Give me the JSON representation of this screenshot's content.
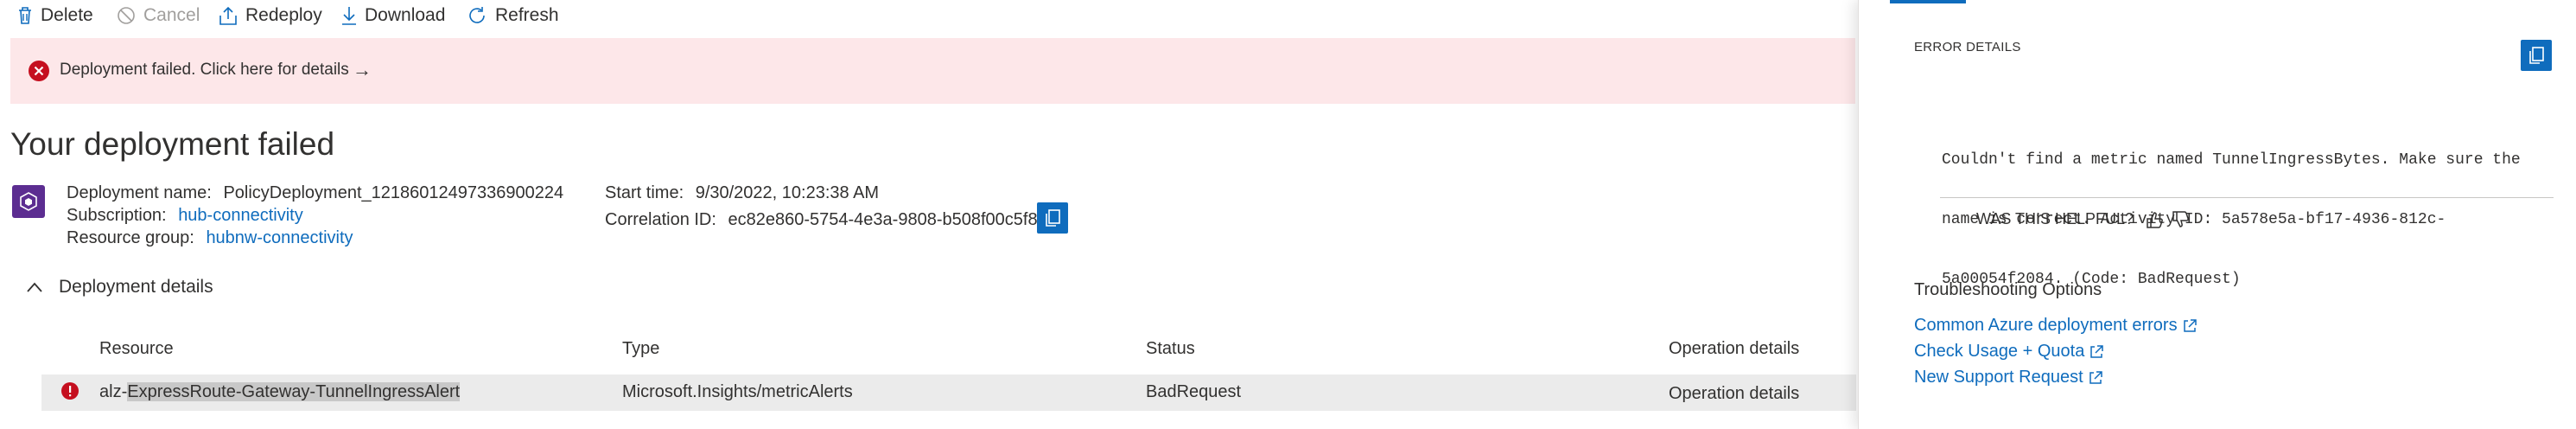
{
  "toolbar": {
    "delete": "Delete",
    "cancel": "Cancel",
    "redeploy": "Redeploy",
    "download": "Download",
    "refresh": "Refresh"
  },
  "banner": {
    "text": "Deployment failed. Click here for details",
    "arrow": "→"
  },
  "title": "Your deployment failed",
  "summary": {
    "deployment_name_label": "Deployment name:",
    "deployment_name": "PolicyDeployment_12186012497336900224",
    "subscription_label": "Subscription:",
    "subscription": "hub-connectivity",
    "resource_group_label": "Resource group:",
    "resource_group": "hubnw-connectivity",
    "start_time_label": "Start time:",
    "start_time": "9/30/2022, 10:23:38 AM",
    "correlation_label": "Correlation ID:",
    "correlation_id": "ec82e860-5754-4e3a-9808-b508f00c5f87"
  },
  "details": {
    "section_label": "Deployment details",
    "columns": [
      "Resource",
      "Type",
      "Status",
      "Operation details"
    ],
    "row": {
      "resource_prefix": "alz-",
      "resource_highlight": "ExpressRoute-Gateway-TunnelIngressAlert",
      "type": "Microsoft.Insights/metricAlerts",
      "status": "BadRequest",
      "operation": "Operation details"
    }
  },
  "panel": {
    "header": "ERROR DETAILS",
    "message_lines": [
      "Couldn't find a metric named TunnelIngressBytes. Make sure the",
      "name is correct. Activity ID: 5a578e5a-bf17-4936-812c-",
      "5a00054f2084. (Code: BadRequest)"
    ],
    "helpful": "WAS THIS HELPFUL?",
    "troubleshooting_title": "Troubleshooting Options",
    "links": [
      "Common Azure deployment errors",
      "Check Usage + Quota",
      "New Support Request"
    ]
  },
  "colors": {
    "accent": "#0f6cbd",
    "error": "#c50f1f",
    "banner_bg": "#fde7e9"
  }
}
